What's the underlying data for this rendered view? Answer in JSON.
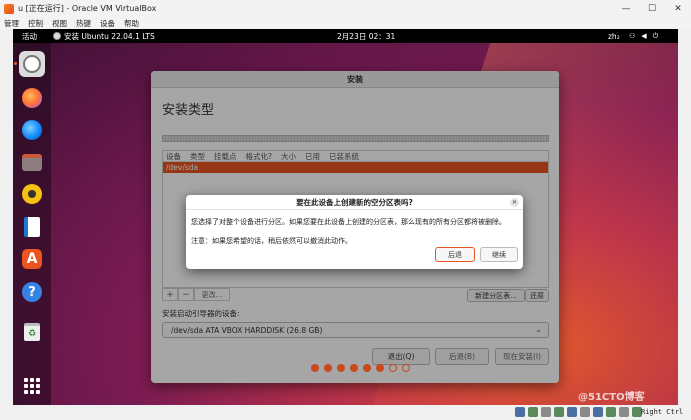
{
  "host": {
    "title": "u [正在运行] - Oracle VM VirtualBox",
    "window_controls": [
      "—",
      "☐",
      "✕"
    ],
    "menu": [
      "管理",
      "控制",
      "视图",
      "热键",
      "设备",
      "帮助"
    ],
    "host_key": "Right Ctrl"
  },
  "guest": {
    "topbar": {
      "activities": "活动",
      "app_name": "安装 Ubuntu 22.04.1 LTS",
      "clock": "2月23日  02：31",
      "language": "zh₂",
      "system_icons": [
        "network-icon",
        "volume-icon",
        "power-icon"
      ]
    },
    "dock": {
      "items": [
        "installer-icon",
        "firefox-icon",
        "thunderbird-icon",
        "files-icon",
        "rhythmbox-icon",
        "writer-icon",
        "app-center-icon",
        "help-icon",
        "trash-icon",
        "show-apps-icon"
      ],
      "trash_glyph": "♻"
    },
    "watermark": "@51CTO博客"
  },
  "installer": {
    "window_title": "安装",
    "page_title": "安装类型",
    "table": {
      "columns": [
        "设备",
        "类型",
        "挂载点",
        "格式化?",
        "大小",
        "已用",
        "已装系统"
      ],
      "rows": [
        "/dev/sda"
      ]
    },
    "table_buttons": {
      "add": "+",
      "remove": "−",
      "change": "更改..."
    },
    "new_table_button": "新建分区表...",
    "revert_button": "还原",
    "boot_label": "安装启动引导器的设备:",
    "boot_device": "/dev/sda ATA VBOX HARDDISK (26.8 GB)",
    "buttons": {
      "quit": "退出(Q)",
      "back": "后退(B)",
      "install_now": "现在安装(I)"
    },
    "progress": {
      "done": 6,
      "total": 8
    }
  },
  "dialog": {
    "title": "要在此设备上创建新的空分区表吗?",
    "close": "✕",
    "message": "您选择了对整个设备进行分区。如果您要在此设备上创建的分区表，那么现有的所有分区都将被删除。",
    "note": "注意：如果您希望的话，稍后依然可以撤消此动作。",
    "back_button": "后退",
    "continue_button": "继续"
  },
  "colors": {
    "accent": "#e95420",
    "topbar": "#000000",
    "dot_active": "#c9491c"
  }
}
